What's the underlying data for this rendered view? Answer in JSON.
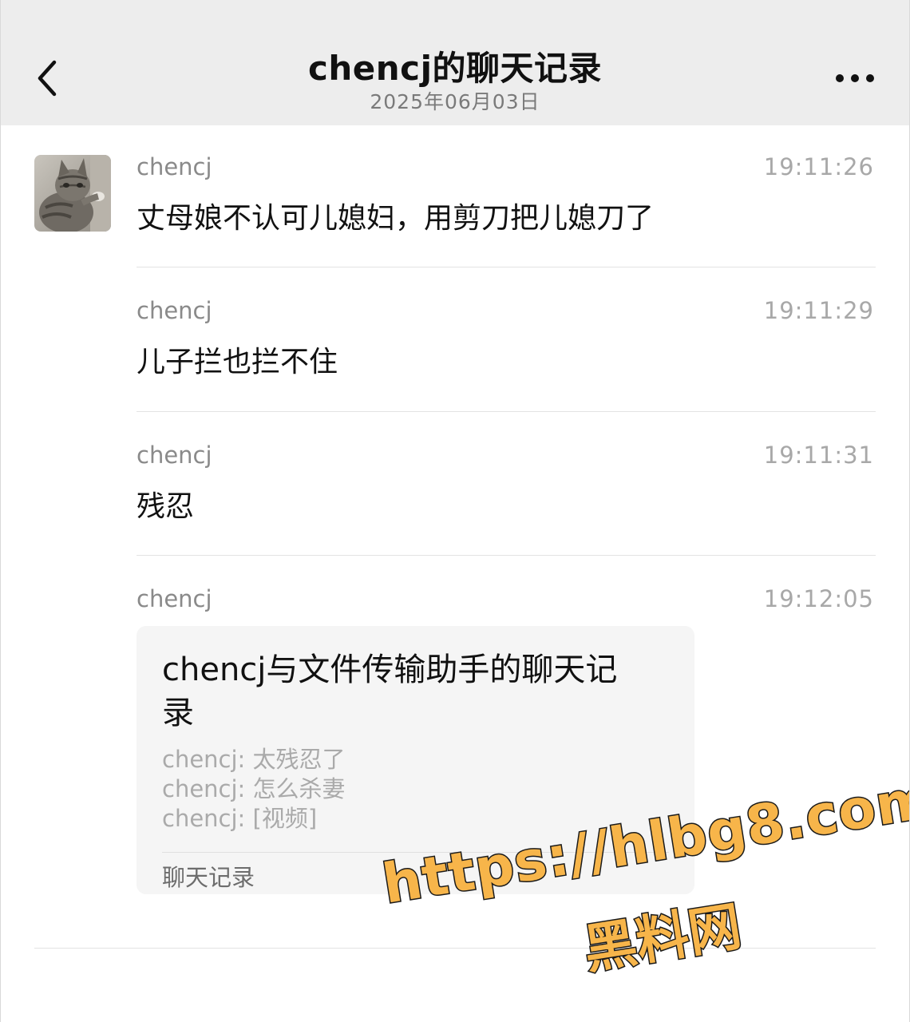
{
  "header": {
    "title": "chencj的聊天记录",
    "subtitle": "2025年06月03日"
  },
  "icons": {
    "back": "chevron-left-icon",
    "more": "more-dots-icon",
    "avatar": "cat-photo-avatar"
  },
  "messages": [
    {
      "sender": "chencj",
      "time": "19:11:26",
      "text": "丈母娘不认可儿媳妇，用剪刀把儿媳刀了"
    },
    {
      "sender": "chencj",
      "time": "19:11:29",
      "text": "儿子拦也拦不住"
    },
    {
      "sender": "chencj",
      "time": "19:11:31",
      "text": "残忍"
    },
    {
      "sender": "chencj",
      "time": "19:12:05"
    }
  ],
  "card": {
    "title": "chencj与文件传输助手的聊天记录",
    "lines": [
      "chencj: 太残忍了",
      "chencj: 怎么杀妻",
      "chencj: [视频]"
    ],
    "footer": "聊天记录"
  },
  "watermark": {
    "url": "https://hlbg8.com",
    "name": "黑料网",
    "color": "#f7b54a"
  }
}
